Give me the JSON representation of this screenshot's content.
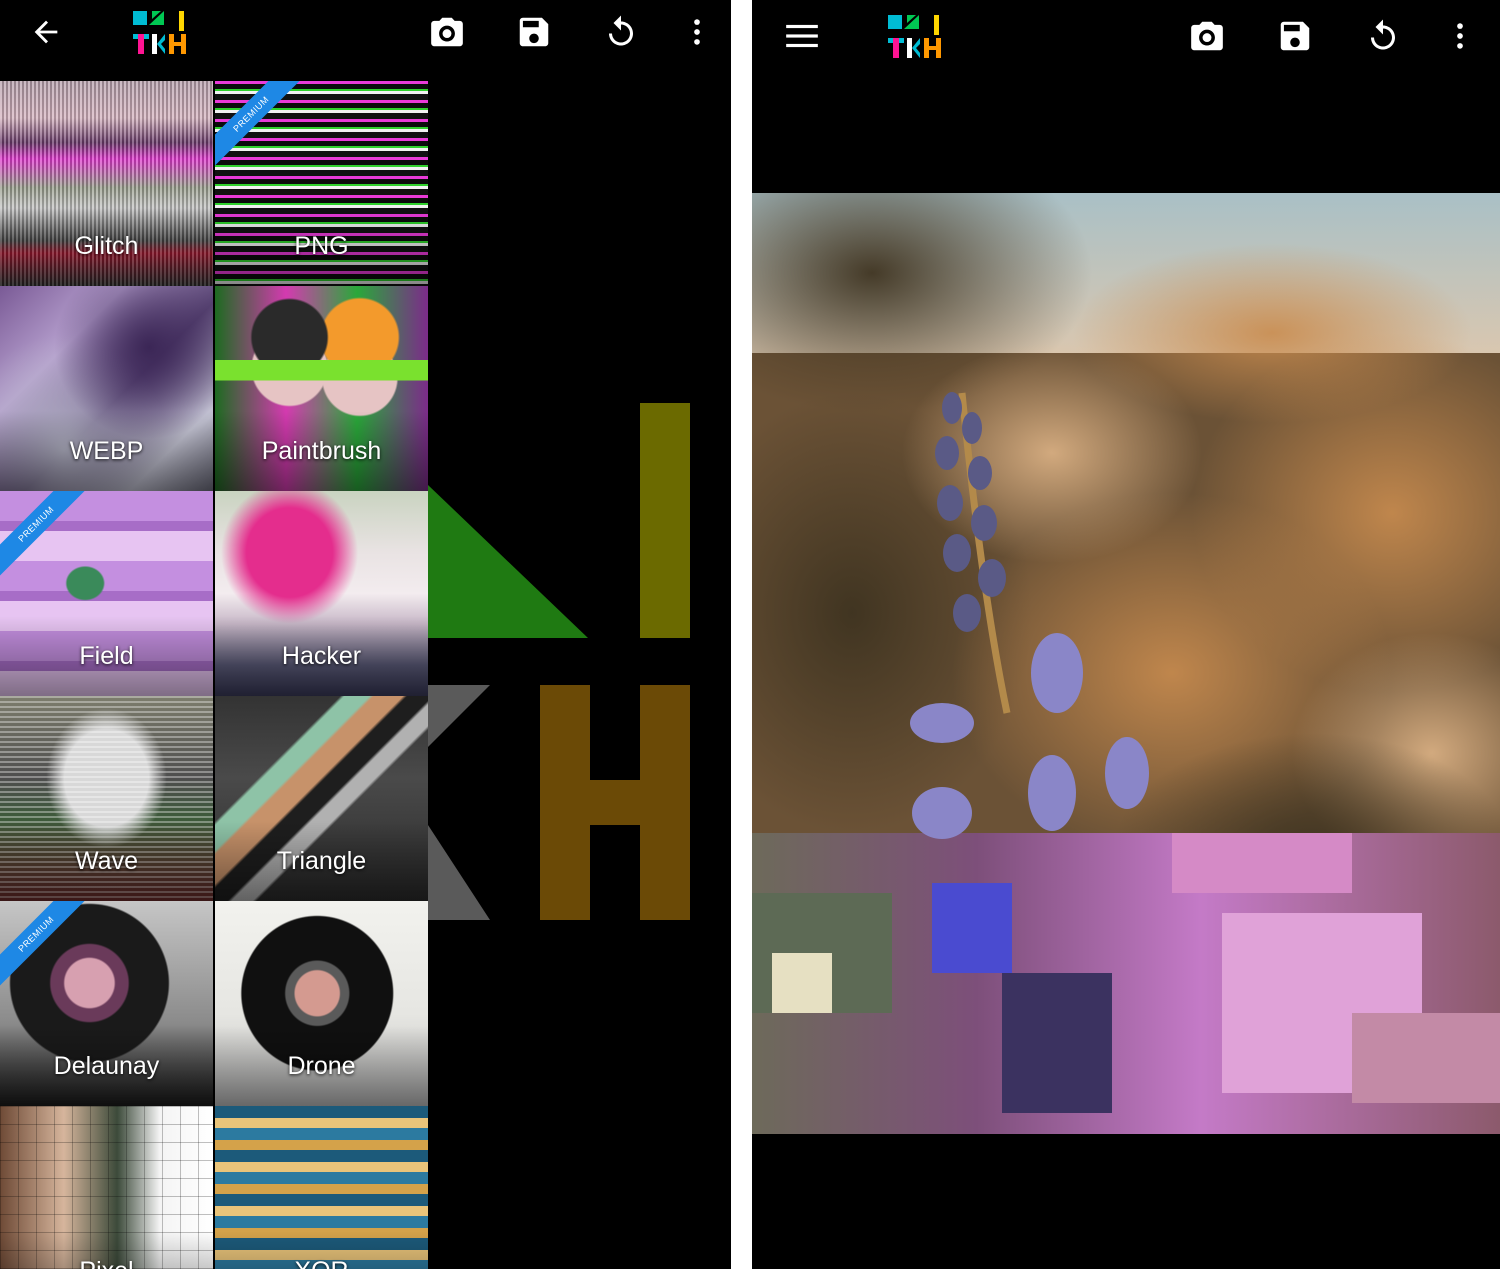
{
  "left": {
    "toolbar": {
      "back_icon": "arrow-back-icon",
      "camera_icon": "camera-icon",
      "save_icon": "save-icon",
      "undo_icon": "undo-icon",
      "more_icon": "more-vert-icon"
    },
    "effects": [
      {
        "label": "Glitch",
        "premium": false
      },
      {
        "label": "PNG",
        "premium": true
      },
      {
        "label": "WEBP",
        "premium": false
      },
      {
        "label": "Paintbrush",
        "premium": false
      },
      {
        "label": "Field",
        "premium": true
      },
      {
        "label": "Hacker",
        "premium": false
      },
      {
        "label": "Wave",
        "premium": false
      },
      {
        "label": "Triangle",
        "premium": false
      },
      {
        "label": "Delaunay",
        "premium": true
      },
      {
        "label": "Drone",
        "premium": false
      },
      {
        "label": "Pixel",
        "premium": false
      },
      {
        "label": "XOR",
        "premium": false
      }
    ],
    "premium_ribbon": "PREMIUM"
  },
  "right": {
    "toolbar": {
      "menu_icon": "hamburger-menu-icon",
      "camera_icon": "camera-icon",
      "save_icon": "save-icon",
      "undo_icon": "undo-icon",
      "more_icon": "more-vert-icon"
    }
  },
  "colors": {
    "background": "#000000",
    "ribbon": "#1e88e5",
    "logo_cyan": "#00bcd4",
    "logo_green": "#00c853",
    "logo_yellow": "#ffd600",
    "logo_orange": "#ff9800",
    "logo_pink": "#ff1493"
  }
}
